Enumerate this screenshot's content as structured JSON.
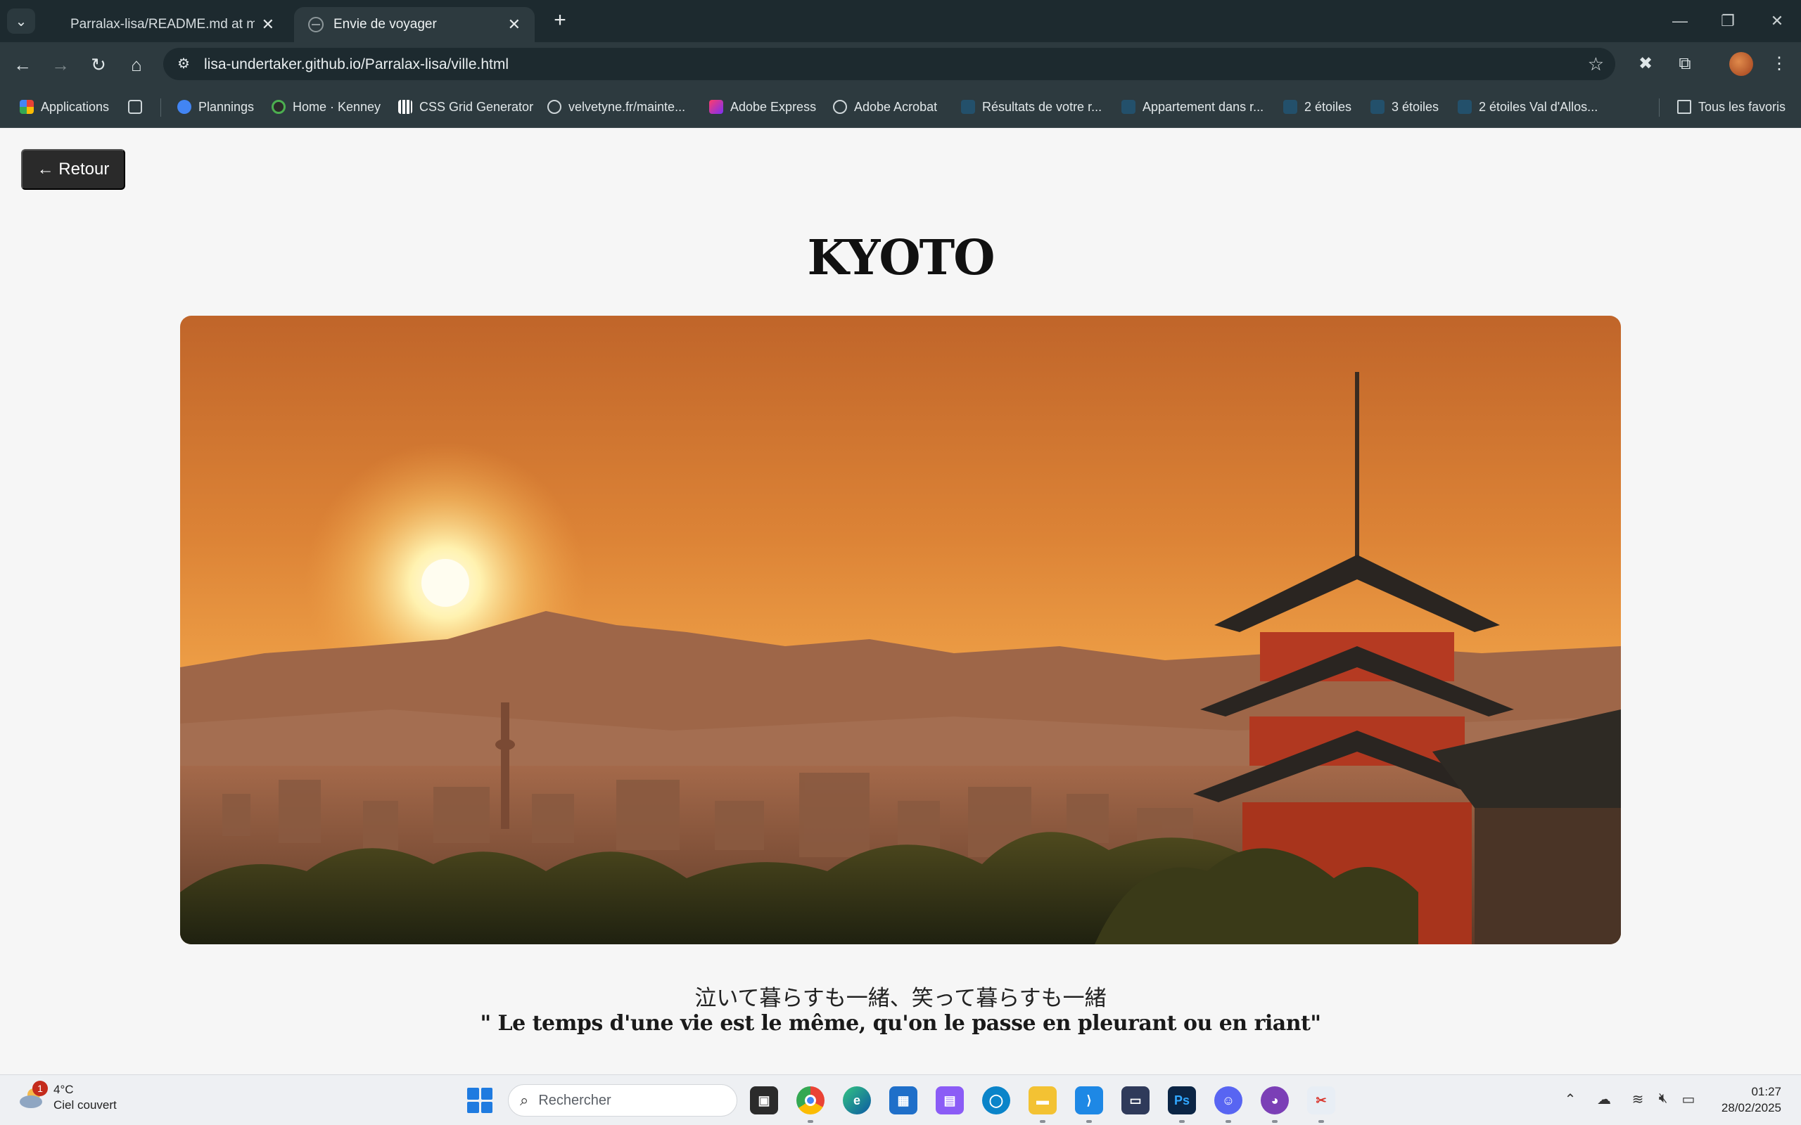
{
  "browser": {
    "tabs": [
      {
        "title": "Parralax-lisa/README.md at main · lisa-undertaker/Parralax-lisa",
        "active": false
      },
      {
        "title": "Envie de voyager",
        "active": true
      }
    ],
    "url": "lisa-undertaker.github.io/Parralax-lisa/ville.html",
    "bookmarks": [
      {
        "label": "Applications"
      },
      {
        "label": "Plannings"
      },
      {
        "label": "Home · Kenney"
      },
      {
        "label": "CSS Grid Generator"
      },
      {
        "label": "velvetyne.fr/mainte..."
      },
      {
        "label": "Adobe Express"
      },
      {
        "label": "Adobe Acrobat"
      },
      {
        "label": "Résultats de votre r..."
      },
      {
        "label": "Appartement dans r..."
      },
      {
        "label": "2 étoiles"
      },
      {
        "label": "3 étoiles"
      },
      {
        "label": "2 étoiles Val d'Allos..."
      }
    ],
    "all_bookmarks": "Tous les favoris"
  },
  "page": {
    "back_label": "← Retour",
    "city": "KYOTO",
    "hero_alt": "Kyoto",
    "quote_jp": "泣いて暮らすも一緒、笑って暮らすも一緒",
    "quote_fr": "\" Le temps d'une vie est le même, qu'on le passe en pleurant ou en riant\""
  },
  "taskbar": {
    "weather_temp": "4°C",
    "weather_desc": "Ciel couvert",
    "weather_badge": "1",
    "search_placeholder": "Rechercher",
    "time": "01:27",
    "date": "28/02/2025"
  }
}
